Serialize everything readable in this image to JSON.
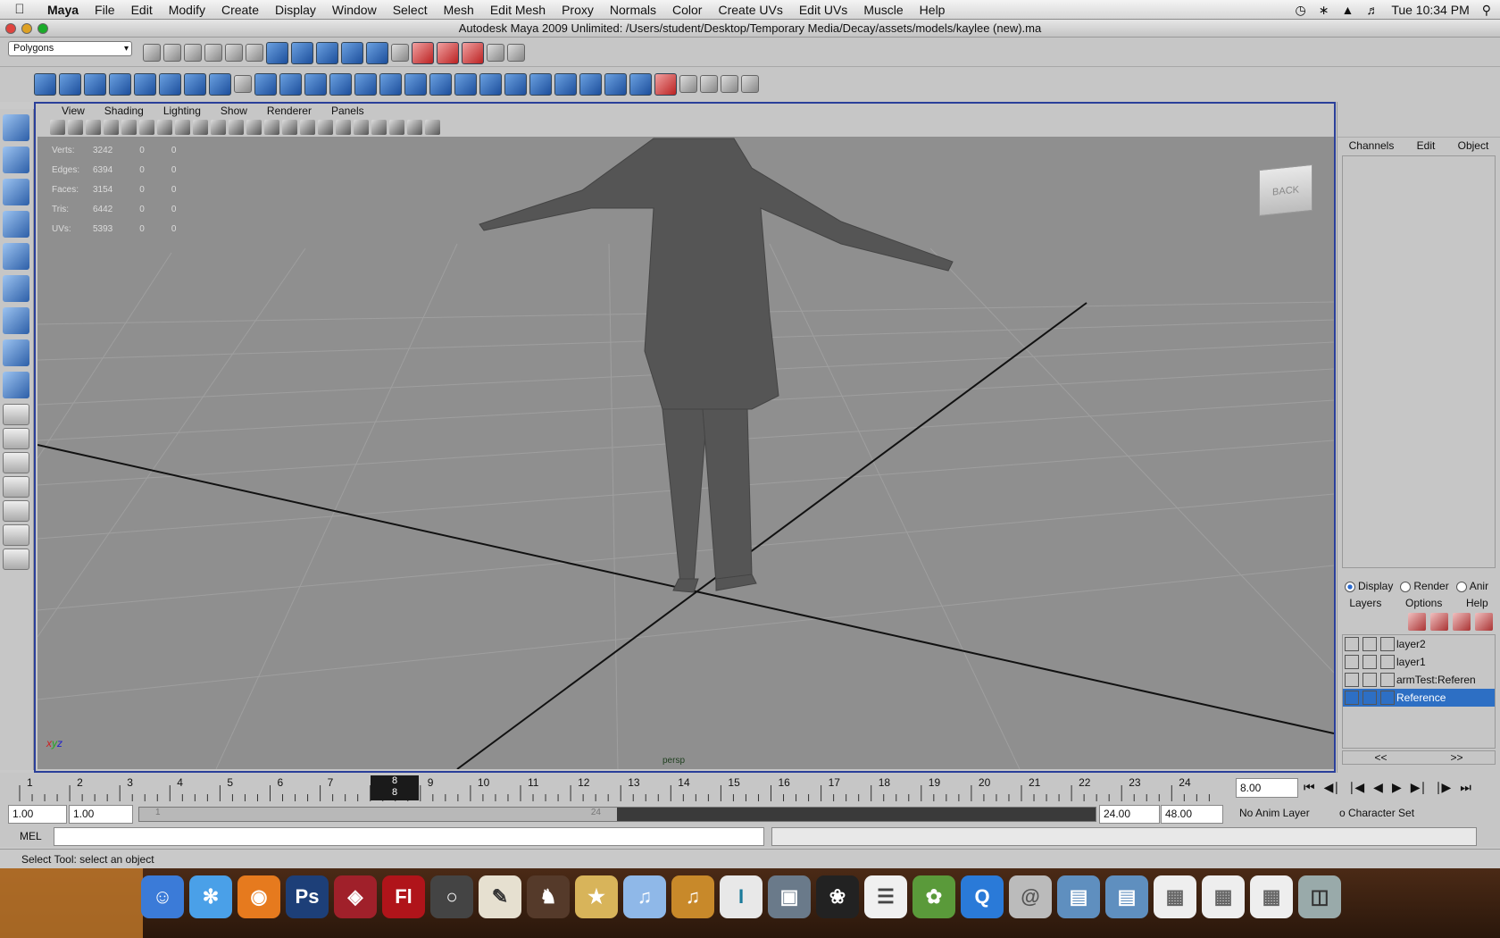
{
  "menubar": {
    "app": "Maya",
    "items": [
      "File",
      "Edit",
      "Modify",
      "Create",
      "Display",
      "Window",
      "Select",
      "Mesh",
      "Edit Mesh",
      "Proxy",
      "Normals",
      "Color",
      "Create UVs",
      "Edit UVs",
      "Muscle",
      "Help"
    ],
    "clock": "Tue 10:34 PM"
  },
  "window": {
    "title": "Autodesk Maya 2009 Unlimited: /Users/student/Desktop/Temporary Media/Decay/assets/models/kaylee (new).ma"
  },
  "toolbar": {
    "mode": "Polygons",
    "x_label": "X",
    "y_label": "Y",
    "z_label": "Z"
  },
  "panel": {
    "menus": [
      "View",
      "Shading",
      "Lighting",
      "Show",
      "Renderer",
      "Panels"
    ],
    "camera": "persp",
    "viewcube": "BACK"
  },
  "hud": [
    {
      "label": "Verts:",
      "a": "3242",
      "b": "0",
      "c": "0"
    },
    {
      "label": "Edges:",
      "a": "6394",
      "b": "0",
      "c": "0"
    },
    {
      "label": "Faces:",
      "a": "3154",
      "b": "0",
      "c": "0"
    },
    {
      "label": "Tris:",
      "a": "6442",
      "b": "0",
      "c": "0"
    },
    {
      "label": "UVs:",
      "a": "5393",
      "b": "0",
      "c": "0"
    }
  ],
  "channelbox": {
    "tabs": [
      "Channels",
      "Edit",
      "Object"
    ]
  },
  "layers": {
    "modes": [
      "Display",
      "Render",
      "Anir"
    ],
    "menus": [
      "Layers",
      "Options",
      "Help"
    ],
    "list": [
      "layer2",
      "layer1",
      "armTest:Referen",
      "Reference"
    ],
    "prev": "<<",
    "next": ">>"
  },
  "timeline": {
    "ticks": [
      "1",
      "2",
      "3",
      "4",
      "5",
      "6",
      "7",
      "8",
      "9",
      "10",
      "11",
      "12",
      "13",
      "14",
      "15",
      "16",
      "17",
      "18",
      "19",
      "20",
      "21",
      "22",
      "23",
      "24"
    ],
    "current": "8",
    "current_field": "8.00"
  },
  "range": {
    "start": "1.00",
    "playstart": "1.00",
    "playend": "24.00",
    "end": "48.00",
    "slider_start": "1",
    "slider_end": "24",
    "anim_layer": "No Anim Layer",
    "char_set": "o Character Set"
  },
  "command": {
    "label": "MEL"
  },
  "status": {
    "text": "Select Tool: select an object"
  }
}
